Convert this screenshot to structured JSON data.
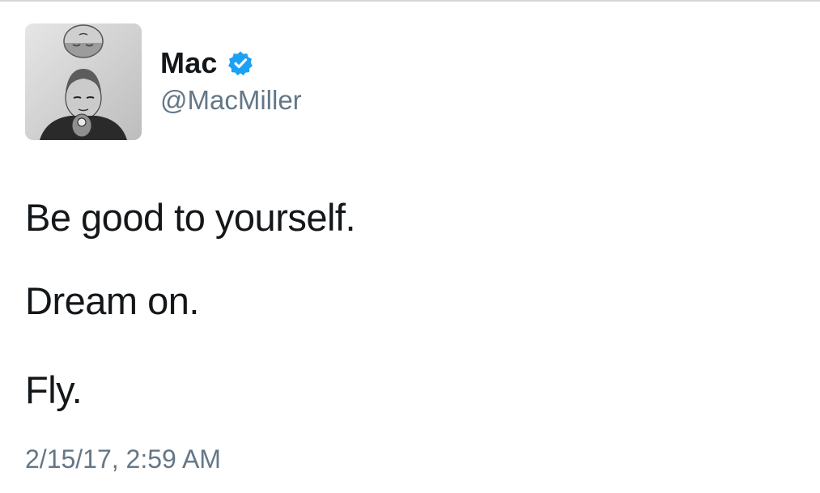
{
  "author": {
    "display_name": "Mac",
    "handle": "@MacMiller",
    "verified": true,
    "verified_color": "#1da1f2",
    "avatar_icon": "grayscale-profile-photo"
  },
  "tweet": {
    "lines": [
      "Be good to yourself.",
      "Dream on.",
      "Fly."
    ],
    "timestamp": "2/15/17, 2:59 AM"
  },
  "colors": {
    "text": "#14171a",
    "secondary_text": "#657786",
    "background": "#ffffff"
  }
}
